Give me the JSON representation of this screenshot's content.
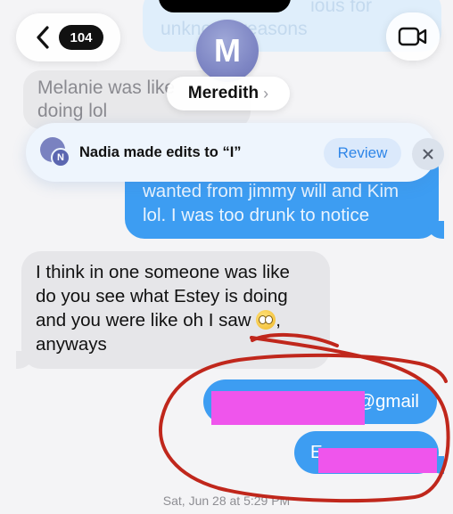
{
  "header": {
    "back_count": "104",
    "avatar_initial": "M",
    "contact_name": "Meredith",
    "name_chevron": "›"
  },
  "messages": {
    "top_fragment_line1": "ious for",
    "top_fragment_line2": "unknown reasons",
    "melanie_line1": "Melanie was like",
    "melanie_line2": "doing lol",
    "blue_line1": "wanted from jimmy will and Kim",
    "blue_line2": "lol. I was too drunk to notice",
    "grey_line1": "I think in one someone was like",
    "grey_line2": "do you see what Estey is doing",
    "grey_line3": "and you were like oh I saw",
    "grey_line3_tail": ",",
    "grey_line4": "anyways",
    "gmail_text": "@gmail",
    "e_text": "E"
  },
  "banner": {
    "avatar_letters": "N",
    "text": "Nadia made edits to “I”",
    "review_label": "Review",
    "close_symbol": "✕"
  },
  "timestamp": "Sat, Jun 28 at 5:29 PM",
  "colors": {
    "imessage_blue": "#3d9df2",
    "incoming_grey": "#e6e6e9",
    "redaction_pink": "#ef55ec",
    "scribble_red": "#c0271c"
  },
  "icons": {
    "back": "chevron-left-icon",
    "video": "video-camera-icon",
    "close": "close-icon"
  }
}
